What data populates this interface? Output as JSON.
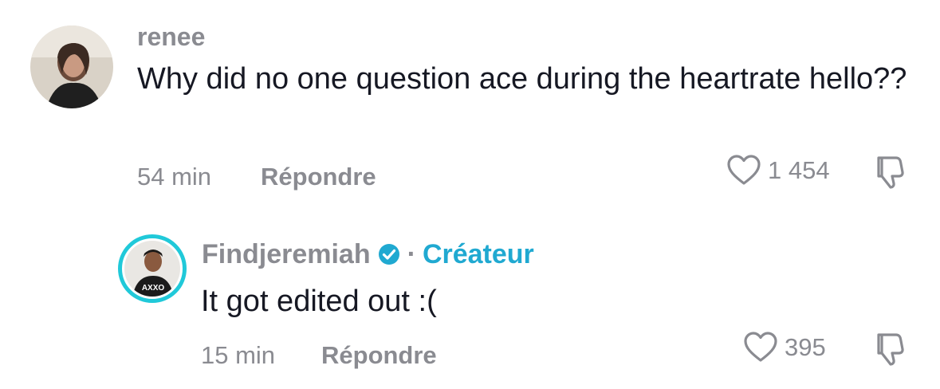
{
  "comments": [
    {
      "username": "renee",
      "text": "Why did no one question ace during the heartrate hello??",
      "time": "54 min",
      "reply_label": "Répondre",
      "likes": "1 454",
      "avatar_icon": "user-photo-avatar",
      "like_icon": "heart-outline-icon",
      "dislike_icon": "thumbs-down-icon"
    }
  ],
  "reply": {
    "username": "Findjeremiah",
    "verified_icon": "verified-check-icon",
    "separator": "·",
    "creator_label": "Créateur",
    "text": "It got edited out :(",
    "time": "15 min",
    "reply_label": "Répondre",
    "likes": "395",
    "avatar_icon": "creator-photo-avatar",
    "like_icon": "heart-outline-icon",
    "dislike_icon": "thumbs-down-icon"
  },
  "colors": {
    "muted_text": "#8a8b91",
    "primary_text": "#161823",
    "creator_accent": "#20a9d1",
    "avatar_ring": "#20c9d9"
  }
}
